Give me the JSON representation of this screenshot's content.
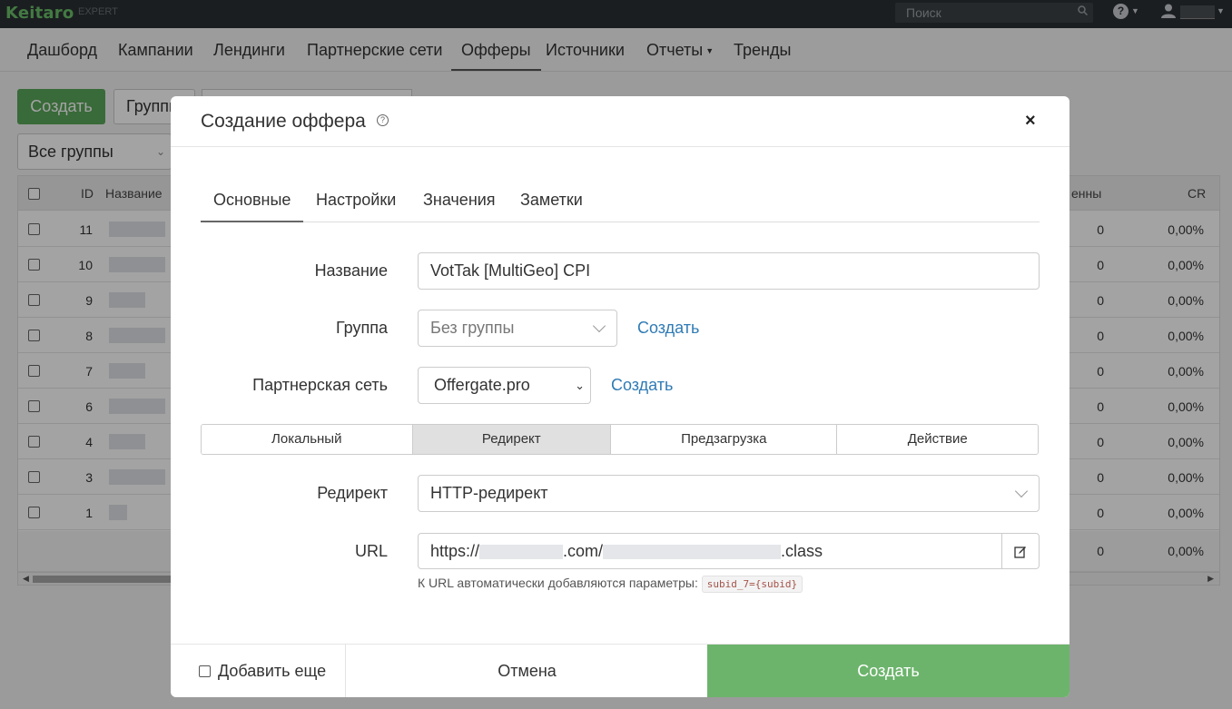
{
  "app": {
    "logo": "Keitaro",
    "edition": "EXPERT",
    "search_placeholder": "Поиск",
    "help_label": "?"
  },
  "nav": [
    "Дашборд",
    "Кампании",
    "Лендинги",
    "Партнерские сети",
    "Офферы",
    "Источники",
    "Отчеты",
    "Тренды"
  ],
  "nav_active": "Офферы",
  "background": {
    "create_button": "Создать",
    "groups_button": "Группы",
    "groups_filter": "Все группы",
    "columns": {
      "id": "ID",
      "name": "Название",
      "shown": "енны",
      "cr": "CR"
    },
    "rows": [
      {
        "id": "11",
        "shown": "0",
        "cr": "0,00%"
      },
      {
        "id": "10",
        "shown": "0",
        "cr": "0,00%"
      },
      {
        "id": "9",
        "shown": "0",
        "cr": "0,00%"
      },
      {
        "id": "8",
        "shown": "0",
        "cr": "0,00%"
      },
      {
        "id": "7",
        "shown": "0",
        "cr": "0,00%"
      },
      {
        "id": "6",
        "shown": "0",
        "cr": "0,00%"
      },
      {
        "id": "4",
        "shown": "0",
        "cr": "0,00%"
      },
      {
        "id": "3",
        "shown": "0",
        "cr": "0,00%"
      },
      {
        "id": "1",
        "shown": "0",
        "cr": "0,00%"
      }
    ],
    "totals": {
      "shown": "0",
      "cr": "0,00%"
    }
  },
  "modal": {
    "title": "Создание оффера",
    "help_label": "?",
    "close_label": "×",
    "tabs": [
      "Основные",
      "Настройки",
      "Значения",
      "Заметки"
    ],
    "active_tab": "Основные",
    "fields": {
      "name_label": "Название",
      "name_value": "VotTak [MultiGeo] CPI",
      "group_label": "Группа",
      "group_value": "Без группы",
      "group_create": "Создать",
      "network_label": "Партнерская сеть",
      "network_value": "Offergate.pro",
      "network_create": "Создать",
      "redirect_label": "Редирект",
      "redirect_value": "HTTP-редирект",
      "url_label": "URL",
      "url_prefix": "https://",
      "url_mid": ".com/",
      "url_suffix": ".class",
      "url_hint": "К URL автоматически добавляются параметры:",
      "url_hint_code": "subid_7={subid}"
    },
    "modes": [
      "Локальный",
      "Редирект",
      "Предзагрузка",
      "Действие"
    ],
    "active_mode": "Редирект",
    "footer": {
      "add_more": "Добавить еще",
      "cancel": "Отмена",
      "submit": "Создать"
    }
  },
  "colors": {
    "brand_green": "#6abf69",
    "submit_green": "#6cb46c",
    "link_blue": "#2f7bb5",
    "topbar": "#2b2f33"
  }
}
